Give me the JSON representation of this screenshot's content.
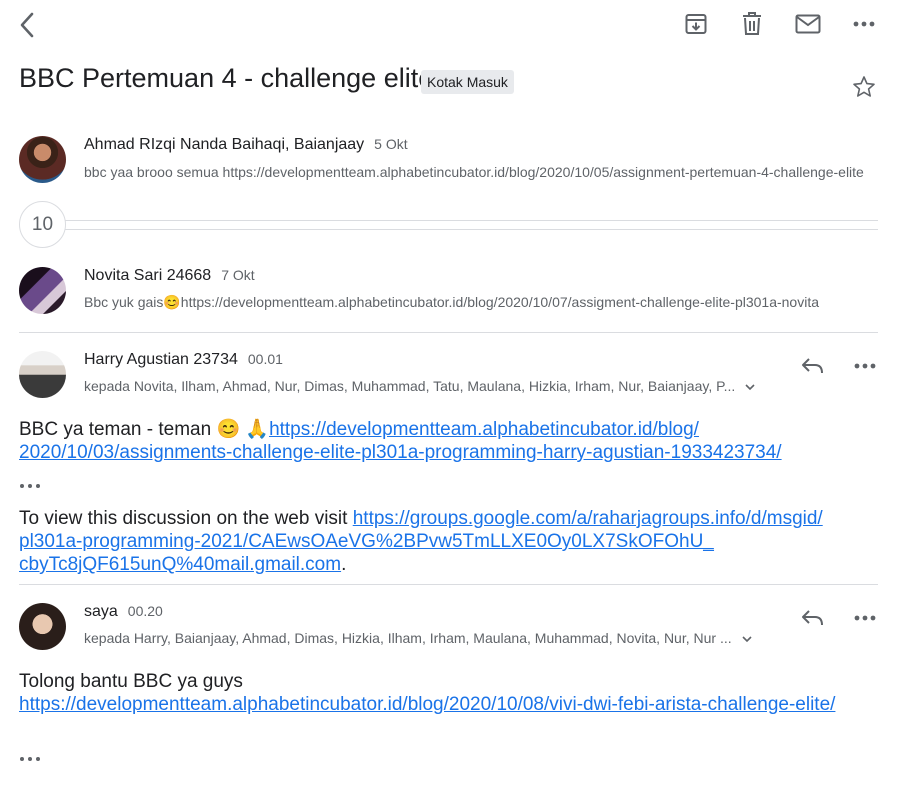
{
  "thread": {
    "subject": "BBC Pertemuan 4 - challenge elite",
    "label": "Kotak Masuk",
    "collapsed_count": "10"
  },
  "messages": [
    {
      "sender": "Ahmad RIzqi Nanda Baihaqi, Baianjaay",
      "date": "5 Okt",
      "snippet": "bbc yaa brooo semua https://developmentteam.alphabetincubator.id/blog/2020/10/05/assignment-pertemuan-4-challenge-elite"
    },
    {
      "sender": "Novita Sari 24668",
      "date": "7 Okt",
      "snippet": "Bbc yuk gais😊https://developmentteam.alphabetincubator.id/blog/2020/10/07/assigment-challenge-elite-pl301a-novita"
    },
    {
      "sender": "Harry Agustian 23734",
      "date": "00.01",
      "recipients": "kepada Novita, Ilham, Ahmad, Nur, Dimas, Muhammad, Tatu, Maulana, Hizkia, Irham, Nur, Baianjaay, P...",
      "body_prefix": "BBC ya teman - teman 😊 🙏",
      "body_link_1": "https://developmentteam.alphabetincubator.id/blog/",
      "body_link_2": "2020/10/03/assignments-challenge-elite-pl301a-programming-harry-agustian-1933423734/",
      "footer_text": "To view this discussion on the web visit ",
      "footer_link_1": "https://groups.google.com/a/raharjagroups.info/d/msgid/",
      "footer_link_2": "pl301a-programming-2021/CAEwsOAeVG%2BPvw5TmLLXE0Oy0LX7SkOFOhU_",
      "footer_link_3": "cbyTc8jQF615unQ%40mail.gmail.com",
      "footer_end": "."
    },
    {
      "sender": "saya",
      "date": "00.20",
      "recipients": "kepada Harry, Baianjaay, Ahmad, Dimas, Hizkia, Ilham, Irham, Maulana, Muhammad, Novita, Nur, Nur ...",
      "body_text": "Tolong bantu BBC ya guys",
      "body_link": "https://developmentteam.alphabetincubator.id/blog/2020/10/08/vivi-dwi-febi-arista-challenge-elite/"
    }
  ],
  "colors": {
    "link": "#1a73e8",
    "secondary": "#5f6368",
    "divider": "#dadce0"
  }
}
